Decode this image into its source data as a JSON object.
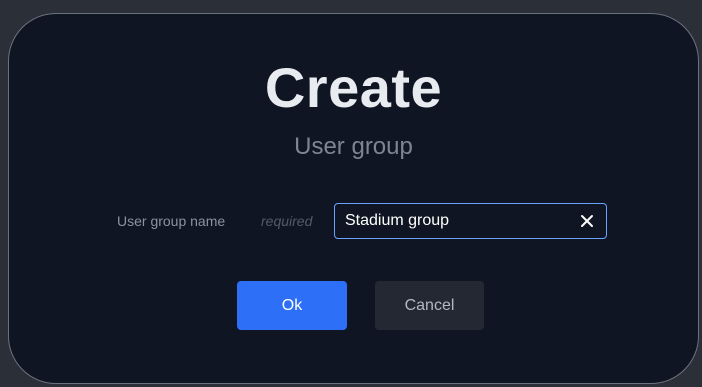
{
  "dialog": {
    "title": "Create",
    "subtitle": "User group"
  },
  "form": {
    "user_group_name": {
      "label": "User group name",
      "required_text": "required",
      "value": "Stadium group",
      "clear_icon": "close-icon"
    }
  },
  "actions": {
    "ok_label": "Ok",
    "cancel_label": "Cancel"
  },
  "colors": {
    "page_background": "#2b2f38",
    "dialog_background": "#0f1522",
    "dialog_border": "#6b7280",
    "title_text": "#e8ebf0",
    "subtitle_text": "#7d8593",
    "input_focus_border": "#6aa3ff",
    "ok_button": "#2d6ff7",
    "cancel_button": "#232833"
  }
}
